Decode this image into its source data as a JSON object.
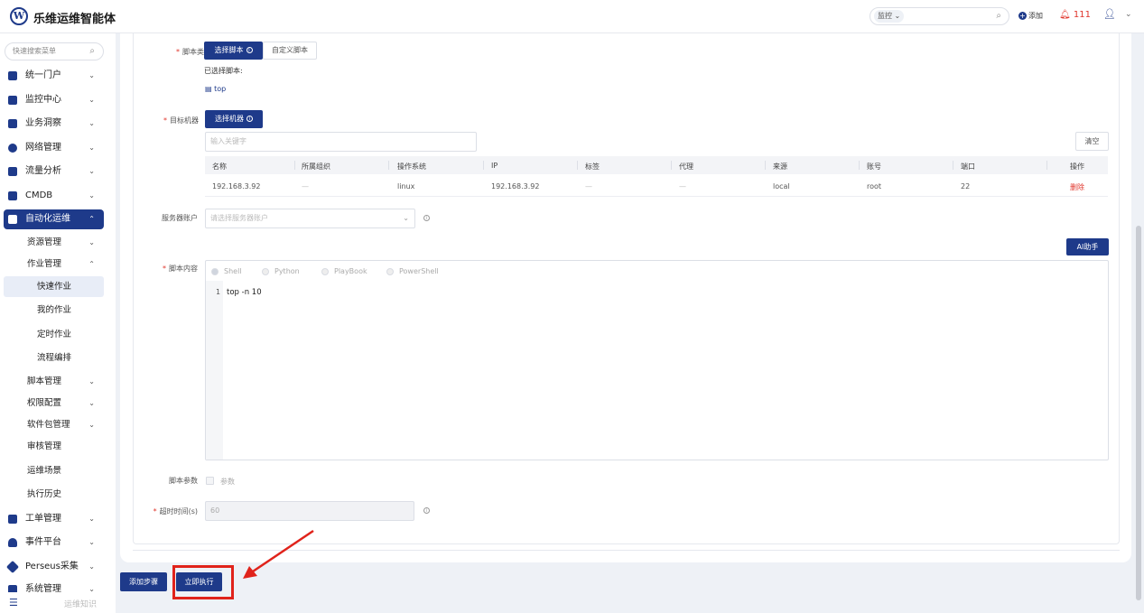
{
  "header": {
    "logo_letter": "W",
    "title": "乐维运维智能体",
    "search_scope": "监控",
    "add_label": "添加",
    "alert_count": "111"
  },
  "sidebar": {
    "search_placeholder": "快速搜索菜单",
    "items": [
      {
        "label": "统一门户"
      },
      {
        "label": "监控中心"
      },
      {
        "label": "业务洞察"
      },
      {
        "label": "网络管理"
      },
      {
        "label": "流量分析"
      },
      {
        "label": "CMDB"
      },
      {
        "label": "自动化运维",
        "active": true
      },
      {
        "label": "工单管理"
      },
      {
        "label": "事件平台"
      },
      {
        "label": "Perseus采集"
      },
      {
        "label": "系统管理"
      }
    ],
    "automation_sub": [
      {
        "label": "资源管理"
      },
      {
        "label": "作业管理"
      },
      {
        "label": "脚本管理"
      },
      {
        "label": "权限配置"
      },
      {
        "label": "软件包管理"
      },
      {
        "label": "审核管理"
      },
      {
        "label": "运维场景"
      },
      {
        "label": "执行历史"
      }
    ],
    "job_sub": [
      {
        "label": "快速作业",
        "active": true
      },
      {
        "label": "我的作业"
      },
      {
        "label": "定时作业"
      },
      {
        "label": "流程编排"
      }
    ],
    "footer_text": "运维知识"
  },
  "form": {
    "script_type_label": "脚本类型",
    "select_script_btn": "选择脚本",
    "custom_script_btn": "自定义脚本",
    "selected_script_label": "已选择脚本:",
    "selected_script_name": "top",
    "target_machine_label": "目标机器",
    "select_machine_btn": "选择机器",
    "keyword_placeholder": "输入关键字",
    "clear_btn": "清空",
    "table": {
      "headers": [
        "名称",
        "所属组织",
        "操作系统",
        "IP",
        "标签",
        "代理",
        "来源",
        "账号",
        "端口",
        "操作"
      ],
      "rows": [
        [
          "192.168.3.92",
          "—",
          "linux",
          "192.168.3.92",
          "—",
          "—",
          "local",
          "root",
          "22",
          "删除"
        ]
      ]
    },
    "server_account_label": "服务器账户",
    "server_account_placeholder": "请选择服务器账户",
    "ai_assist_btn": "AI助手",
    "script_content_label": "脚本内容",
    "languages": [
      "Shell",
      "Python",
      "PlayBook",
      "PowerShell"
    ],
    "selected_language": "Shell",
    "code_line_number": "1",
    "code": "top -n 10",
    "script_params_label": "脚本参数",
    "params_checkbox_label": "参数",
    "timeout_label": "超时时间(s)",
    "timeout_value": "60"
  },
  "actions": {
    "add_step": "添加步骤",
    "execute_now": "立即执行"
  },
  "colors": {
    "primary": "#1e3a8a",
    "danger": "#e0352b",
    "highlight": "#e0231b"
  }
}
